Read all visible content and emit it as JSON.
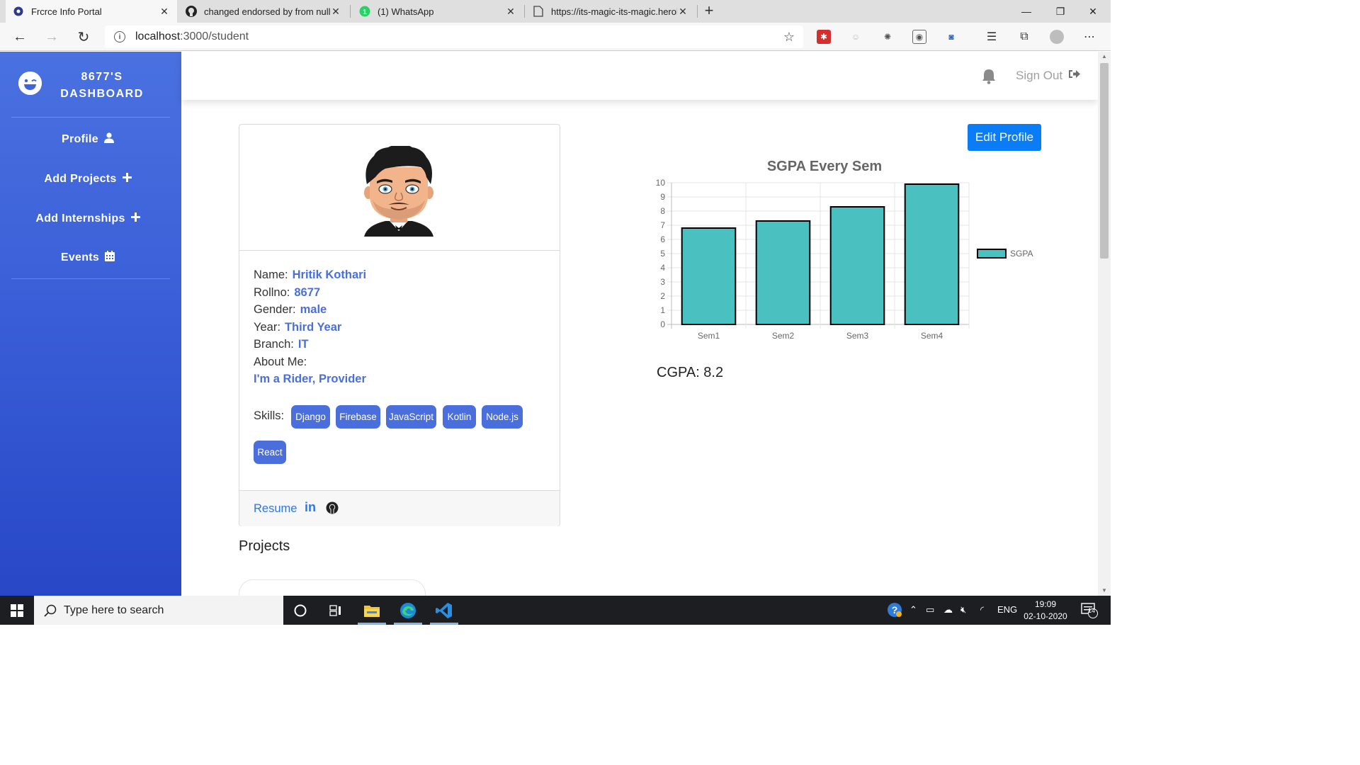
{
  "browser": {
    "tabs": [
      {
        "title": "Frcrce Info Portal",
        "active": true
      },
      {
        "title": "changed endorsed by from null t",
        "active": false
      },
      {
        "title": "(1) WhatsApp",
        "active": false
      },
      {
        "title": "https://its-magic-its-magic.herol",
        "active": false
      }
    ],
    "url_host": "localhost",
    "url_path": ":3000/student"
  },
  "sidebar": {
    "brand_line1": "8677'S",
    "brand_line2": "DASHBOARD",
    "items": [
      {
        "label": "Profile",
        "icon": "user-icon"
      },
      {
        "label": "Add Projects",
        "icon": "plus-icon"
      },
      {
        "label": "Add Internships",
        "icon": "plus-icon"
      },
      {
        "label": "Events",
        "icon": "calendar-icon"
      }
    ]
  },
  "header": {
    "signout_label": "Sign Out"
  },
  "profile": {
    "fields": [
      {
        "label": "Name:",
        "value": "Hritik Kothari"
      },
      {
        "label": "Rollno:",
        "value": "8677"
      },
      {
        "label": "Gender:",
        "value": "male"
      },
      {
        "label": "Year:",
        "value": "Third Year"
      },
      {
        "label": "Branch:",
        "value": "IT"
      }
    ],
    "about_label": "About Me:",
    "about_value": "I'm a Rider, Provider",
    "skills_label": "Skills:",
    "skills": [
      "Django",
      "Firebase",
      "JavaScript",
      "Kotlin",
      "Node.js",
      "React"
    ],
    "resume_label": "Resume",
    "linkedin_label": "in"
  },
  "edit_profile_label": "Edit Profile",
  "cgpa_text": "CGPA: 8.2",
  "projects_heading": "Projects",
  "chart_data": {
    "type": "bar",
    "title": "SGPA Every Sem",
    "categories": [
      "Sem1",
      "Sem2",
      "Sem3",
      "Sem4"
    ],
    "series": [
      {
        "name": "SGPA",
        "values": [
          6.8,
          7.3,
          8.3,
          9.9
        ]
      }
    ],
    "ylim": [
      0,
      10
    ],
    "yticks": [
      0,
      1,
      2,
      3,
      4,
      5,
      6,
      7,
      8,
      9,
      10
    ],
    "grid": true,
    "legend": "right",
    "bar_color": "#4bc0c0"
  },
  "taskbar": {
    "search_placeholder": "Type here to search",
    "lang": "ENG",
    "time": "19:09",
    "date": "02-10-2020",
    "notifications": "14"
  },
  "colors": {
    "sidebar": "#3b5fd8",
    "accent": "#4a6fdc",
    "edit_button": "#0a7cf5"
  }
}
